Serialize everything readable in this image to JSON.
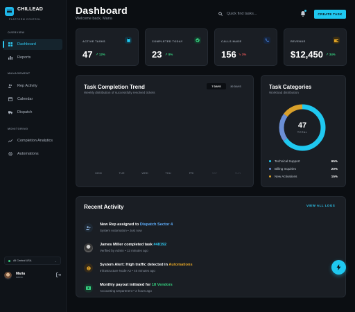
{
  "brand": {
    "name": "CHILLEAD",
    "tagline": "PLATFORM CONTROL",
    "accent": "#1fc8f0"
  },
  "sidebar": {
    "sections": [
      {
        "label": "OVERVIEW",
        "items": [
          {
            "label": "Dashboard",
            "icon": "grid-icon",
            "active": true
          },
          {
            "label": "Reports",
            "icon": "chart-icon"
          }
        ]
      },
      {
        "label": "MANAGEMENT",
        "items": [
          {
            "label": "Rep Activity",
            "icon": "users-icon"
          },
          {
            "label": "Calendar",
            "icon": "calendar-icon"
          },
          {
            "label": "Dispatch",
            "icon": "truck-icon"
          }
        ]
      },
      {
        "label": "MONITORING",
        "items": [
          {
            "label": "Completion Analytics",
            "icon": "trend-icon"
          },
          {
            "label": "Automations",
            "icon": "gear-icon"
          }
        ]
      }
    ],
    "region": "All Central USA",
    "user": {
      "name": "Maria",
      "role": "Admin"
    }
  },
  "header": {
    "title": "Dashboard",
    "subtitle": "Welcome back, Maria",
    "search_placeholder": "Quick find tasks...",
    "create_label": "CREATE TASK"
  },
  "stats": [
    {
      "label": "ACTIVE TASKS",
      "value": "47",
      "delta": "↗ 12%",
      "trend": "up",
      "icon": "clipboard-icon",
      "color": "#1fc8f0"
    },
    {
      "label": "COMPLETED TODAY",
      "value": "23",
      "delta": "↗ 8%",
      "trend": "up",
      "icon": "check-icon",
      "color": "#35d07f"
    },
    {
      "label": "CALLS MADE",
      "value": "156",
      "delta": "↘ 3%",
      "trend": "down",
      "icon": "phone-icon",
      "color": "#4c8df5"
    },
    {
      "label": "REVENUE",
      "value": "$12,450",
      "delta": "↗ 34%",
      "trend": "up",
      "icon": "wallet-icon",
      "color": "#e0a326"
    }
  ],
  "trend_card": {
    "title": "Task Completion Trend",
    "subtitle": "Weekly distribution of successfully resolved tickets",
    "ranges": [
      "7 DAYS",
      "30 DAYS"
    ],
    "active_range": "7 DAYS",
    "days": [
      "MON",
      "TUE",
      "WED",
      "THU",
      "FRI",
      "SAT",
      "SUN"
    ]
  },
  "categories_card": {
    "title": "Task Categories",
    "subtitle": "Workload distribution",
    "total": "47",
    "total_label": "TOTAL",
    "items": [
      {
        "label": "Technical Support",
        "pct": "65%",
        "value": 65,
        "color": "#1fc8f0"
      },
      {
        "label": "Billing Inquiries",
        "pct": "20%",
        "value": 20,
        "color": "#6b8fd6"
      },
      {
        "label": "New Activations",
        "pct": "15%",
        "value": 15,
        "color": "#d9a02a"
      }
    ]
  },
  "activity": {
    "title": "Recent Activity",
    "view_all": "VIEW ALL LOGS",
    "items": [
      {
        "pre": "New Rep assigned to ",
        "hl": "Dispatch Sector 4",
        "hl_color": "#5fb0ff",
        "meta": "System Automation • Just now",
        "icon": "user-plus-icon"
      },
      {
        "pre": "James Miller completed task ",
        "hl": "#48192",
        "hl_color": "#2ec8f0",
        "meta": "Verified by Admin • 12 minutes ago",
        "icon": "avatar-icon"
      },
      {
        "pre": "System Alert: High traffic detected in ",
        "hl": "Automations",
        "hl_color": "#e0a326",
        "meta": "Infrastructure Node A2 • 45 minutes ago",
        "icon": "alert-icon"
      },
      {
        "pre": "Monthly payout initiated for ",
        "hl": "18 Vendors",
        "hl_color": "#35d07f",
        "meta": "Accounting Department • 2 hours ago",
        "icon": "money-icon"
      }
    ]
  }
}
